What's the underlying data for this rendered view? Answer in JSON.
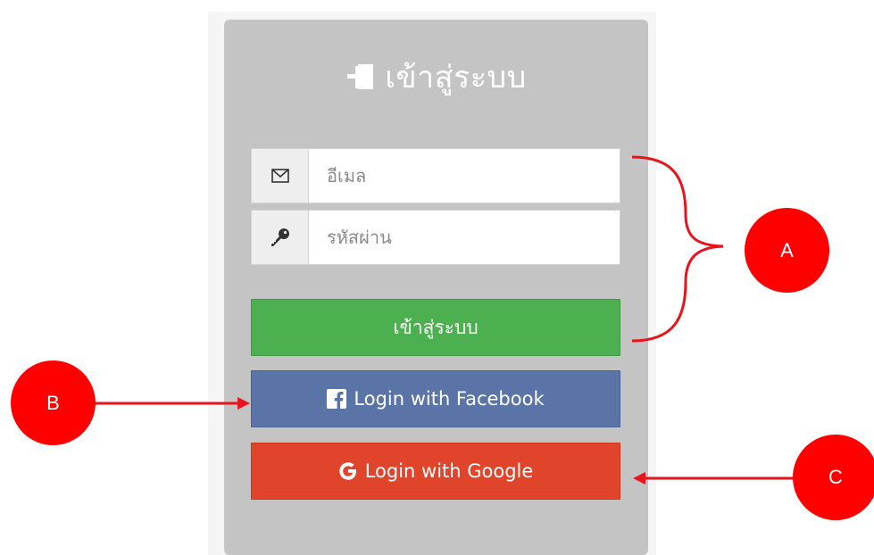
{
  "login": {
    "title": "เข้าสู่ระบบ",
    "email_placeholder": "อีเมล",
    "password_placeholder": "รหัสผ่าน",
    "submit_label": "เข้าสู่ระบบ",
    "facebook_label": "Login with Facebook",
    "google_label": "Login with Google"
  },
  "annotations": {
    "a": "A",
    "b": "B",
    "c": "C"
  },
  "icons": {
    "title": "login-icon",
    "email": "envelope-icon",
    "password": "key-icon",
    "facebook": "facebook-icon",
    "google": "google-icon"
  },
  "colors": {
    "card": "#c4c4c4",
    "login_button": "#4caf50",
    "facebook_button": "#5b74a8",
    "google_button": "#e0442b",
    "annotation": "#ff0000"
  }
}
